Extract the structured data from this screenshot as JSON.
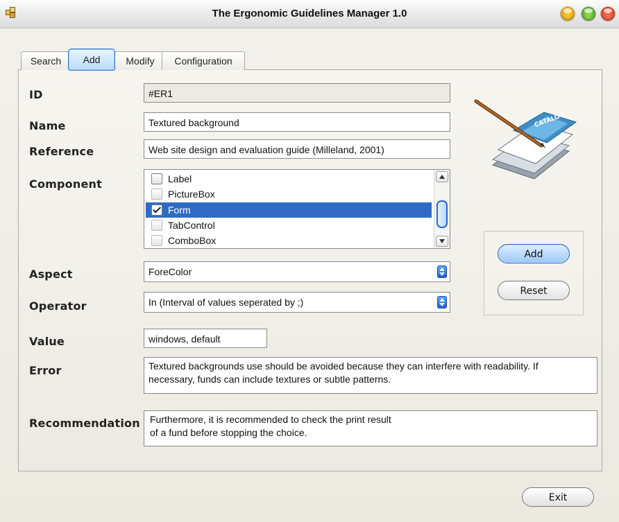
{
  "window": {
    "title": "The Ergonomic Guidelines Manager 1.0"
  },
  "tabs": [
    {
      "label": "Search"
    },
    {
      "label": "Add"
    },
    {
      "label": "Modify"
    },
    {
      "label": "Configuration"
    }
  ],
  "active_tab": "Add",
  "form": {
    "id": {
      "label": "ID",
      "value": "#ER1"
    },
    "name": {
      "label": "Name",
      "value": "Textured background"
    },
    "reference": {
      "label": "Reference",
      "value": "Web site design and evaluation guide (Milleland, 2001)"
    },
    "component": {
      "label": "Component",
      "items": [
        {
          "label": "Label",
          "checked": false
        },
        {
          "label": "PictureBox",
          "checked": false
        },
        {
          "label": "Form",
          "checked": true,
          "selected": true
        },
        {
          "label": "TabControl",
          "checked": false
        },
        {
          "label": "ComboBox",
          "checked": false
        }
      ]
    },
    "aspect": {
      "label": "Aspect",
      "value": "ForeColor"
    },
    "operator": {
      "label": "Operator",
      "value": "In (Interval of values seperated by ;)"
    },
    "value": {
      "label": "Value",
      "value": "windows, default"
    },
    "error": {
      "label": "Error",
      "line1": "Textured backgrounds use should be avoided because they can interfere with readability. If",
      "line2": "necessary, funds can include textures or subtle patterns."
    },
    "recommendation": {
      "label": "Recommendation",
      "line1": "Furthermore, it is recommended to check the print result",
      "line2": "of a fund before stopping the choice."
    }
  },
  "buttons": {
    "add": "Add",
    "reset": "Reset",
    "exit": "Exit"
  },
  "colors": {
    "selection": "#316ac5",
    "active_tab": "#bcdcff",
    "panel": "#eceae2"
  },
  "icons": {
    "app": "app-icon",
    "minimize": "minimize-icon",
    "maximize": "maximize-icon",
    "close": "close-icon",
    "illustration": "catalog-pen-icon",
    "scroll_up": "scroll-up-icon",
    "scroll_down": "scroll-down-icon",
    "combo": "combo-arrows-icon"
  }
}
